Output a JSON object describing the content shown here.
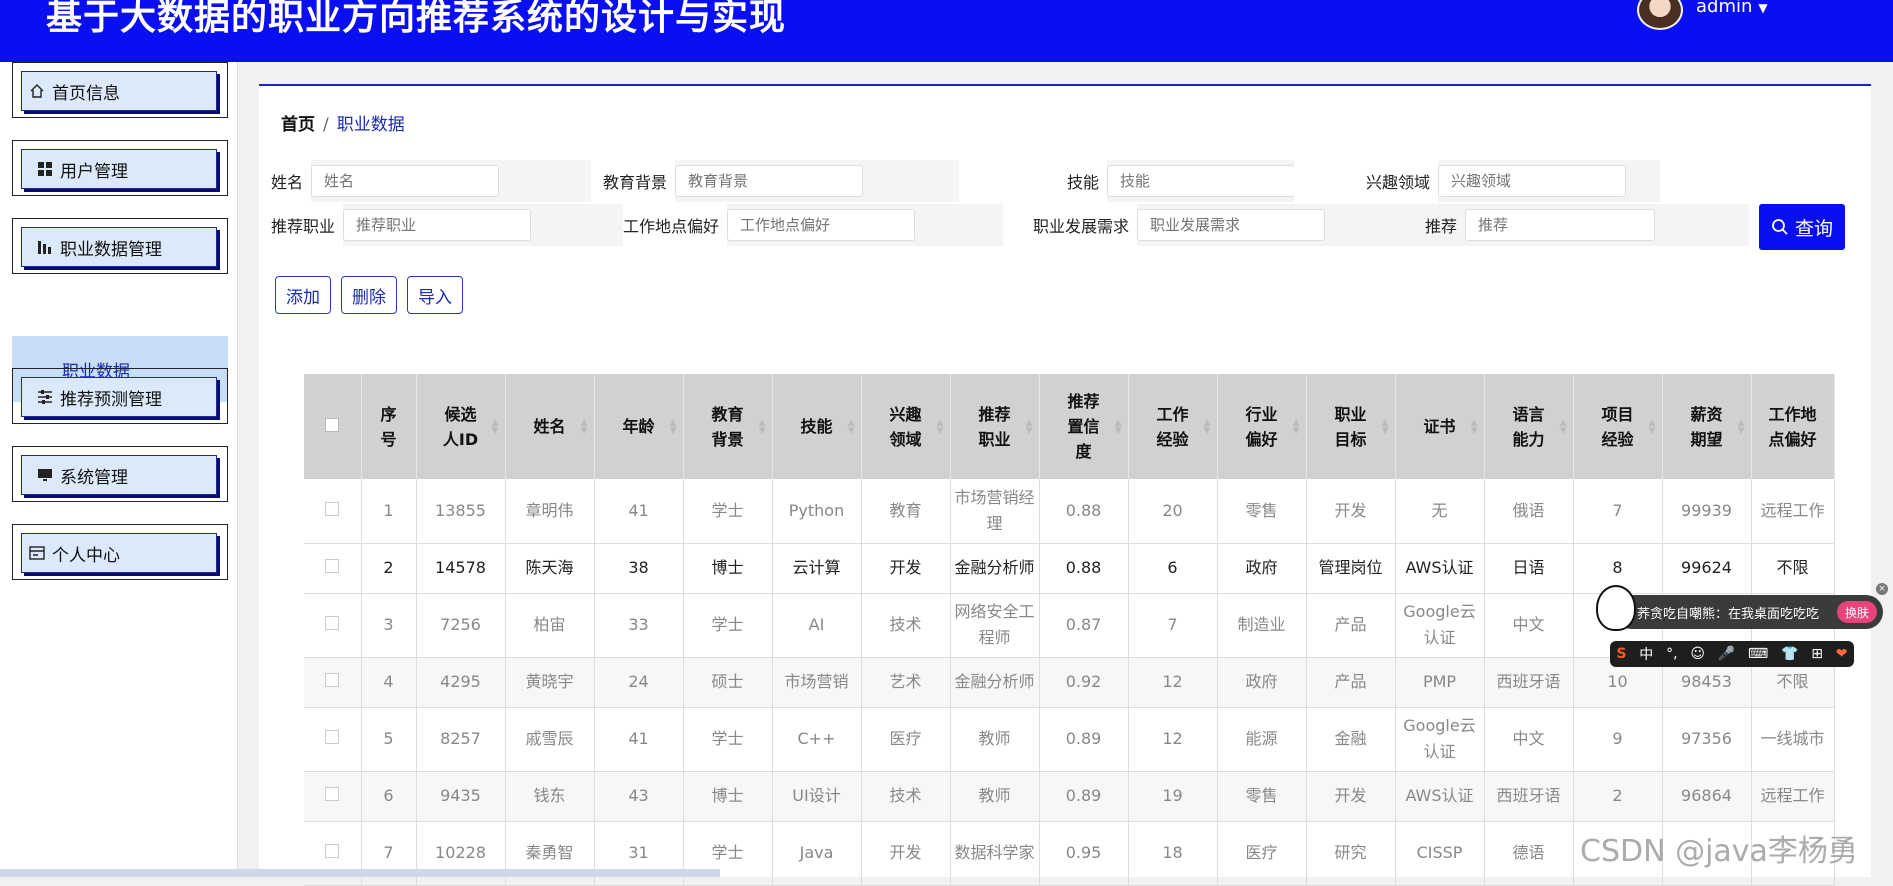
{
  "header": {
    "title": "基于大数据的职业方向推荐系统的设计与实现",
    "user": "admin"
  },
  "sidebar": {
    "items": [
      {
        "label": "首页信息",
        "icon": "home-icon"
      },
      {
        "label": "用户管理",
        "icon": "grid-icon"
      },
      {
        "label": "职业数据管理",
        "icon": "bar-chart-icon"
      },
      {
        "label": "推荐预测管理",
        "icon": "sliders-icon"
      },
      {
        "label": "系统管理",
        "icon": "monitor-icon"
      },
      {
        "label": "个人中心",
        "icon": "card-icon"
      }
    ],
    "sub_item": "职业数据"
  },
  "breadcrumb": {
    "home": "首页",
    "sep": "/",
    "current": "职业数据"
  },
  "filters": [
    {
      "label": "姓名",
      "placeholder": "姓名"
    },
    {
      "label": "教育背景",
      "placeholder": "教育背景"
    },
    {
      "label": "技能",
      "placeholder": "技能"
    },
    {
      "label": "兴趣领域",
      "placeholder": "兴趣领域"
    },
    {
      "label": "推荐职业",
      "placeholder": "推荐职业"
    },
    {
      "label": "工作地点偏好",
      "placeholder": "工作地点偏好"
    },
    {
      "label": "职业发展需求",
      "placeholder": "职业发展需求"
    },
    {
      "label": "推荐",
      "placeholder": "推荐"
    }
  ],
  "search_label": "查询",
  "actions": {
    "add": "添加",
    "delete": "删除",
    "import": "导入"
  },
  "table": {
    "headers": [
      "序号",
      "候选人ID",
      "姓名",
      "年龄",
      "教育背景",
      "技能",
      "兴趣领域",
      "推荐职业",
      "推荐置信度",
      "工作经验",
      "行业偏好",
      "职业目标",
      "证书",
      "语言能力",
      "项目经验",
      "薪资期望",
      "工作地点偏好"
    ],
    "rows": [
      [
        "1",
        "13855",
        "章明伟",
        "41",
        "学士",
        "Python",
        "教育",
        "市场营销经理",
        "0.88",
        "20",
        "零售",
        "开发",
        "无",
        "俄语",
        "7",
        "99939",
        "远程工作"
      ],
      [
        "2",
        "14578",
        "陈天海",
        "38",
        "博士",
        "云计算",
        "开发",
        "金融分析师",
        "0.88",
        "6",
        "政府",
        "管理岗位",
        "AWS认证",
        "日语",
        "8",
        "99624",
        "不限"
      ],
      [
        "3",
        "7256",
        "柏宙",
        "33",
        "学士",
        "AI",
        "技术",
        "网络安全工程师",
        "0.87",
        "7",
        "制造业",
        "产品",
        "Google云认证",
        "中文",
        "",
        "",
        ""
      ],
      [
        "4",
        "4295",
        "黄晓宇",
        "24",
        "硕士",
        "市场营销",
        "艺术",
        "金融分析师",
        "0.92",
        "12",
        "政府",
        "产品",
        "PMP",
        "西班牙语",
        "10",
        "98453",
        "不限"
      ],
      [
        "5",
        "8257",
        "戚雪辰",
        "41",
        "学士",
        "C++",
        "医疗",
        "教师",
        "0.89",
        "12",
        "能源",
        "金融",
        "Google云认证",
        "中文",
        "9",
        "97356",
        "一线城市"
      ],
      [
        "6",
        "9435",
        "钱东",
        "43",
        "博士",
        "UI设计",
        "技术",
        "教师",
        "0.89",
        "19",
        "零售",
        "开发",
        "AWS认证",
        "西班牙语",
        "2",
        "96864",
        "远程工作"
      ],
      [
        "7",
        "10228",
        "秦勇智",
        "31",
        "学士",
        "Java",
        "开发",
        "数据科学家",
        "0.95",
        "18",
        "医疗",
        "研究",
        "CISSP",
        "德语",
        "",
        "",
        ""
      ]
    ]
  },
  "ime": {
    "tip": "荞贪吃自嘲熊：在我桌面吃吃吃",
    "skin": "换肤",
    "bar": [
      "S",
      "中",
      "°,",
      "☺",
      "🎤",
      "⌨",
      "👕",
      "⊞",
      "❤"
    ]
  },
  "watermark": "CSDN @java李杨勇"
}
